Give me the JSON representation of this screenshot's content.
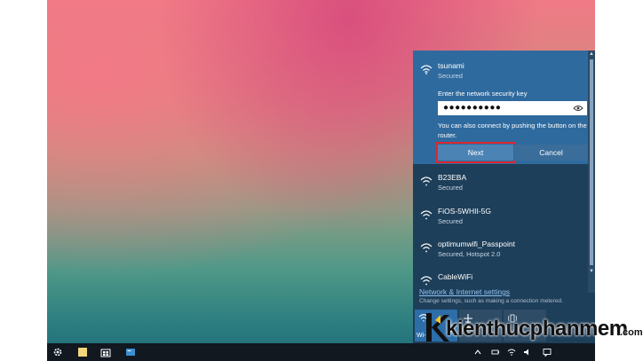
{
  "colors": {
    "panel_bg": "#1e3f5a",
    "selected_bg": "#2f6a9e",
    "next_button_bg": "#4b83b5",
    "cancel_button_bg": "#3a6d9a",
    "highlight_outline": "#e0262e",
    "link_color": "#8fc0ee"
  },
  "wifi": {
    "selected": {
      "name": "tsunami",
      "status": "Secured",
      "key_label": "Enter the network security key",
      "key_value": "●●●●●●●●●●",
      "hint": "You can also connect by pushing the button on the router.",
      "next_label": "Next",
      "cancel_label": "Cancel"
    },
    "networks": [
      {
        "name": "B23EBA",
        "status": "Secured"
      },
      {
        "name": "FiOS-5WHII-5G",
        "status": "Secured"
      },
      {
        "name": "optimumwifi_Passpoint",
        "status": "Secured, Hotspot 2.0"
      },
      {
        "name": "CableWiFi",
        "status": ""
      }
    ],
    "settings_link": "Network & Internet settings",
    "settings_desc": "Change settings, such as making a connection metered.",
    "tiles": [
      {
        "label": "Wi-Fi",
        "icon": "wifi-icon"
      },
      {
        "label": "",
        "icon": "airplane-icon"
      },
      {
        "label": "",
        "icon": "mobile-hotspot-icon"
      }
    ]
  },
  "taskbar": {
    "icons": [
      "gear-icon",
      "sticky-notes-icon",
      "store-icon",
      "app-icon"
    ],
    "tray": [
      "chevron-up-icon",
      "battery-icon",
      "wifi-icon",
      "volume-icon",
      "notification-icon"
    ]
  },
  "watermark": {
    "text": "kienthucphanmem",
    "suffix": ".com"
  }
}
